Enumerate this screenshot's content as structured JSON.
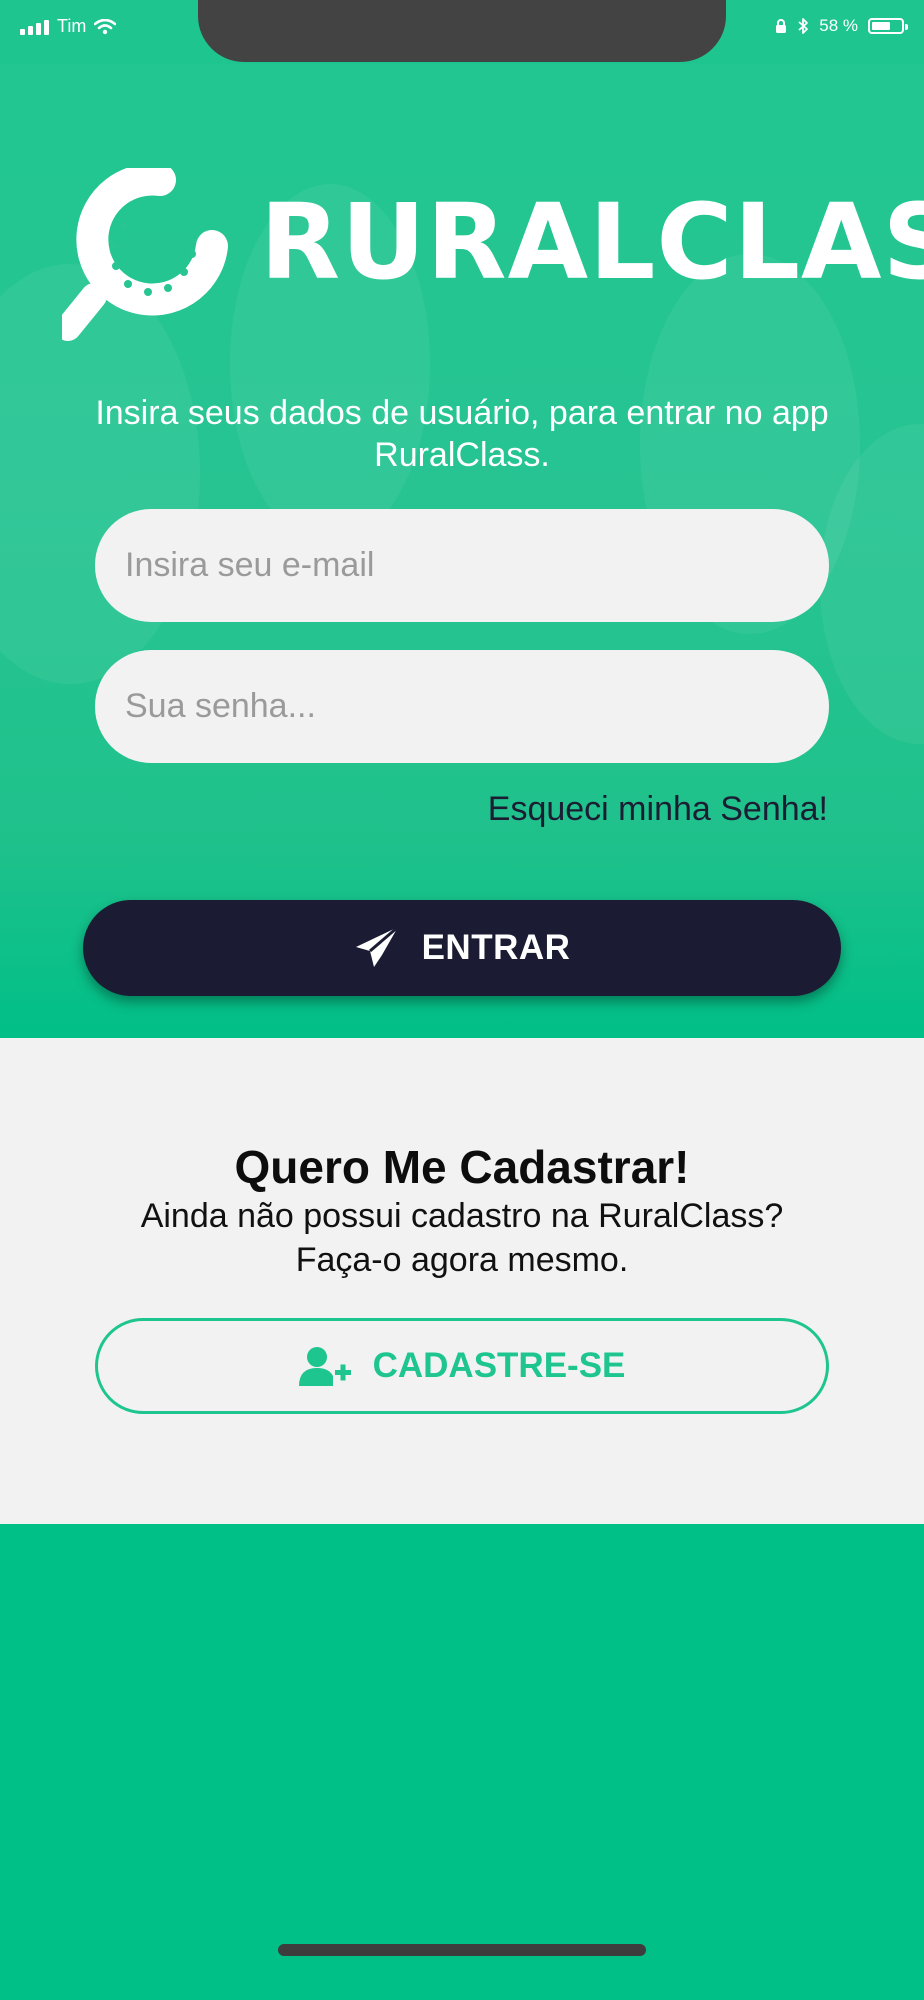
{
  "status_bar": {
    "carrier": "Tim",
    "battery": "58 %",
    "icons": [
      "signal-icon",
      "wifi-icon",
      "lock-icon",
      "bluetooth-icon",
      "battery-icon"
    ]
  },
  "logo": {
    "text": "RURALCLASS"
  },
  "login": {
    "tagline": "Insira seus dados de usuário, para entrar no app RuralClass.",
    "email_placeholder": "Insira seu e-mail",
    "password_placeholder": "Sua senha...",
    "forgot_label": "Esqueci minha Senha!",
    "enter_label": "ENTRAR"
  },
  "signup": {
    "title": "Quero Me Cadastrar!",
    "text_line1": "Ainda não possui cadastro na RuralClass?",
    "text_line2": "Faça-o agora mesmo.",
    "button_label": "CADASTRE-SE"
  },
  "colors": {
    "brand_green": "#1ec58f",
    "bottom_green": "#00bf87",
    "dark_button": "#1b1c33",
    "panel_bg": "#f2f2f2"
  }
}
